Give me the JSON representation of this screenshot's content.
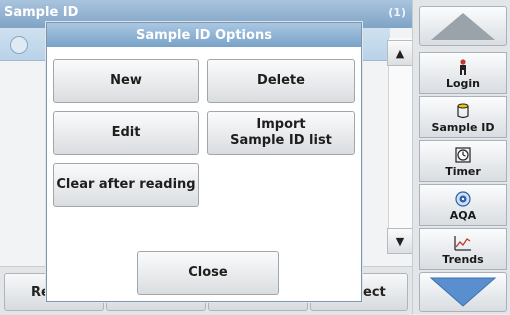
{
  "background": {
    "title": "Sample ID",
    "count": "(1)",
    "bottom_left_label": "Re",
    "bottom_right_label": "ect"
  },
  "sidebar": {
    "items": [
      {
        "label": "Login",
        "icon": "person-icon"
      },
      {
        "label": "Sample ID",
        "icon": "sample-container-icon"
      },
      {
        "label": "Timer",
        "icon": "timer-icon"
      },
      {
        "label": "AQA",
        "icon": "aqa-icon"
      },
      {
        "label": "Trends",
        "icon": "trends-chart-icon"
      }
    ],
    "up_icon": "triangle-up-icon",
    "down_icon": "triangle-down-icon"
  },
  "modal": {
    "title": "Sample ID Options",
    "buttons": {
      "new": "New",
      "delete": "Delete",
      "edit": "Edit",
      "import_line1": "Import",
      "import_line2": "Sample ID list",
      "clear_after_reading": "Clear after reading",
      "close": "Close"
    }
  },
  "colors": {
    "title_bar": "#7fa3c6",
    "accent_blue": "#5a8fcf"
  }
}
